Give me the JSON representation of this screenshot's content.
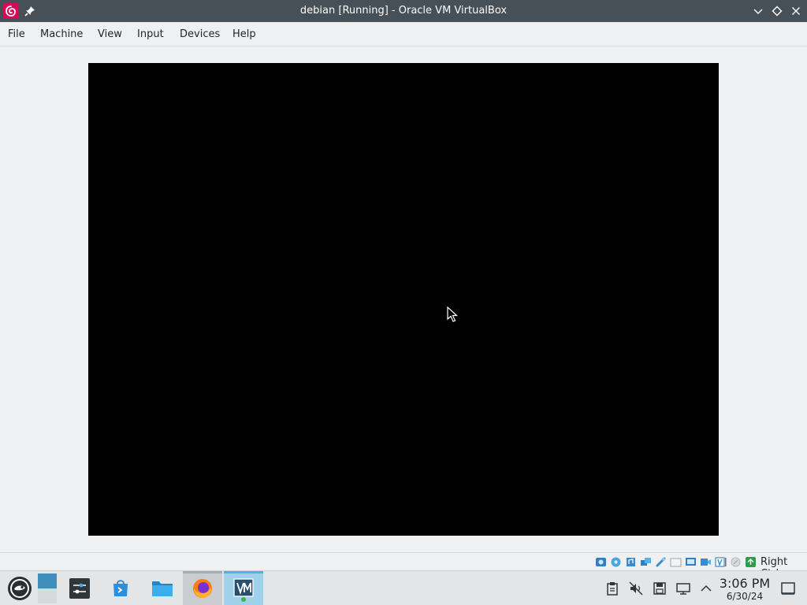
{
  "window": {
    "title": "debian [Running] - Oracle VM VirtualBox",
    "app_icon": "debian-swirl-icon",
    "pin_icon": "pin-icon",
    "buttons": [
      "minimize-icon",
      "maximize-icon",
      "close-icon"
    ]
  },
  "menubar": {
    "items": [
      "File",
      "Machine",
      "View",
      "Input",
      "Devices",
      "Help"
    ]
  },
  "vm": {
    "state": "Running",
    "screen_color": "#000000"
  },
  "statusbar": {
    "icons": [
      "hard-disk-icon",
      "optical-drive-icon",
      "audio-icon",
      "network-icon",
      "usb-icon",
      "shared-folders-icon",
      "display-icon",
      "video-capture-icon",
      "guest-additions-icon",
      "mouse-integration-icon",
      "keyboard-icon"
    ],
    "host_key": "Right Ctrl"
  },
  "taskbar": {
    "launcher_icon": "opensuse-launcher-icon",
    "tasks": [
      {
        "name": "settings-app-icon"
      },
      {
        "name": "discover-store-icon"
      },
      {
        "name": "file-manager-icon"
      },
      {
        "name": "firefox-icon"
      },
      {
        "name": "virtualbox-icon"
      }
    ],
    "tray": [
      "clipboard-icon",
      "volume-muted-icon",
      "save-icon",
      "network-tray-icon",
      "expand-tray-icon"
    ],
    "clock": {
      "time": "3:06 PM",
      "date": "6/30/24"
    },
    "show_desktop_icon": "show-desktop-icon"
  },
  "colors": {
    "titlebar": "#475057",
    "window_bg": "#eff0f1",
    "accent": "#3daee9"
  }
}
